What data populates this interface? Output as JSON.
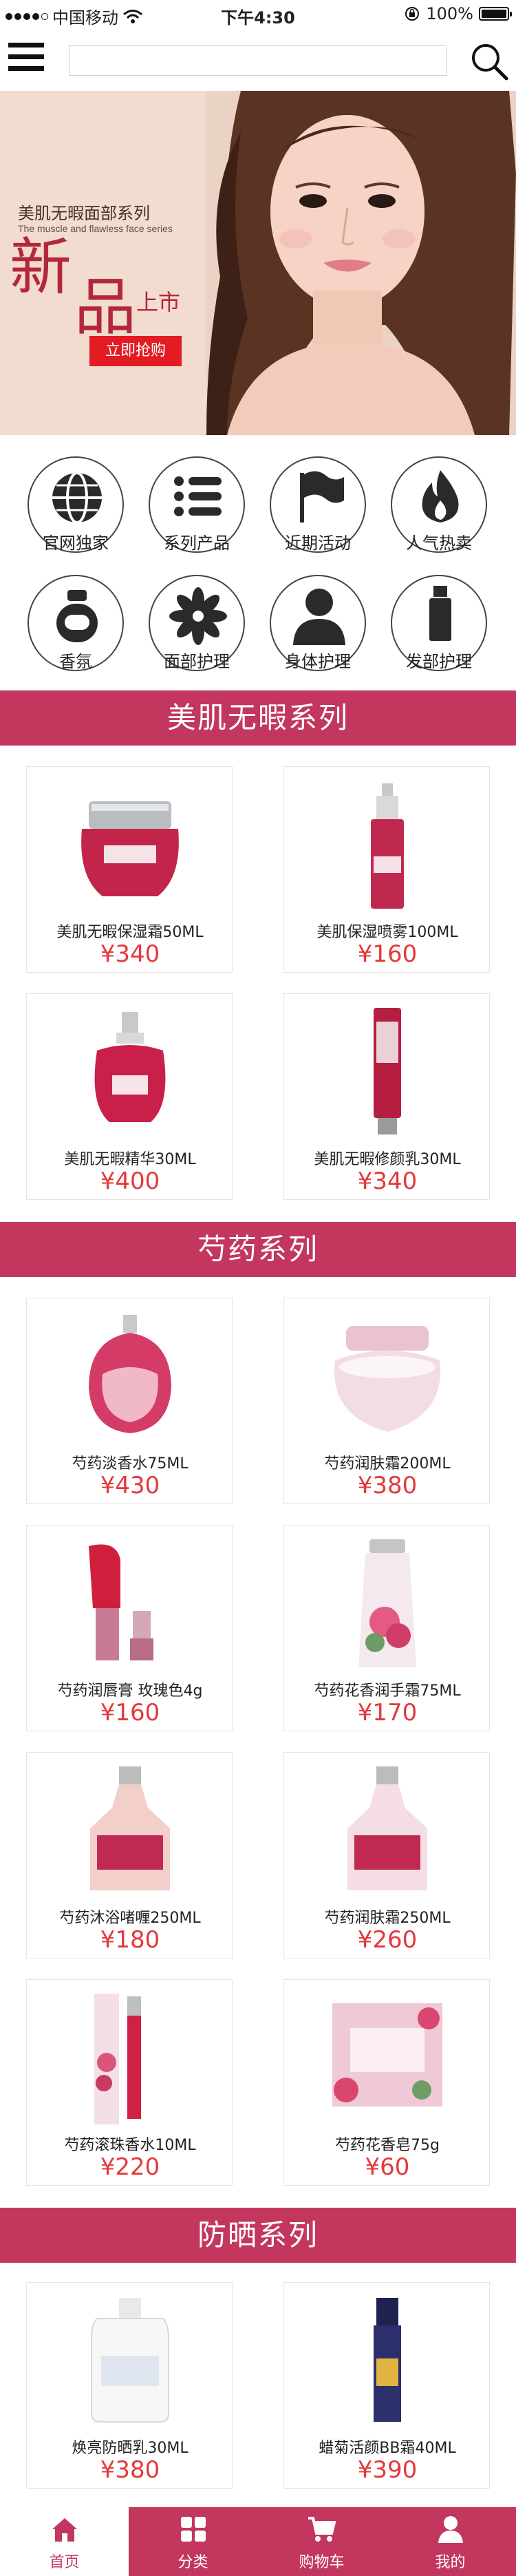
{
  "status_bar": {
    "carrier": "中国移动",
    "time": "下午4:30",
    "battery": "100%"
  },
  "header": {
    "search_placeholder": ""
  },
  "banner": {
    "series_cn": "美肌无暇面部系列",
    "series_en": "The muscle and flawless face series",
    "title_a": "新",
    "title_b": "品",
    "title_c": "上市",
    "buy_button": "立即抢购"
  },
  "categories": [
    {
      "label": "官网独家",
      "icon": "globe-icon"
    },
    {
      "label": "系列产品",
      "icon": "list-icon"
    },
    {
      "label": "近期活动",
      "icon": "flag-icon"
    },
    {
      "label": "人气热卖",
      "icon": "fire-icon"
    },
    {
      "label": "香氛",
      "icon": "perfume-icon"
    },
    {
      "label": "面部护理",
      "icon": "flower-icon"
    },
    {
      "label": "身体护理",
      "icon": "person-icon"
    },
    {
      "label": "发部护理",
      "icon": "bottle-icon"
    }
  ],
  "sections": [
    {
      "title": "美肌无暇系列",
      "products": [
        {
          "name": "美肌无暇保湿霜50ML",
          "price": "¥340"
        },
        {
          "name": "美肌保湿喷雾100ML",
          "price": "¥160"
        },
        {
          "name": "美肌无暇精华30ML",
          "price": "¥400"
        },
        {
          "name": "美肌无暇修颜乳30ML",
          "price": "¥340"
        }
      ]
    },
    {
      "title": "芍药系列",
      "products": [
        {
          "name": "芍药淡香水75ML",
          "price": "¥430"
        },
        {
          "name": "芍药润肤霜200ML",
          "price": "¥380"
        },
        {
          "name": "芍药润唇膏 玫瑰色4g",
          "price": "¥160"
        },
        {
          "name": "芍药花香润手霜75ML",
          "price": "¥170"
        },
        {
          "name": "芍药沐浴啫喱250ML",
          "price": "¥180"
        },
        {
          "name": "芍药润肤霜250ML",
          "price": "¥260"
        },
        {
          "name": "芍药滚珠香水10ML",
          "price": "¥220"
        },
        {
          "name": "芍药花香皂75g",
          "price": "¥60"
        }
      ]
    },
    {
      "title": "防晒系列",
      "products": [
        {
          "name": "焕亮防晒乳30ML",
          "price": "¥380"
        },
        {
          "name": "蜡菊活颜BB霜40ML",
          "price": "¥390"
        }
      ]
    }
  ],
  "tabbar": [
    {
      "label": "首页",
      "icon": "home-icon",
      "active": true
    },
    {
      "label": "分类",
      "icon": "grid-icon",
      "active": false
    },
    {
      "label": "购物车",
      "icon": "cart-icon",
      "active": false
    },
    {
      "label": "我的",
      "icon": "user-icon",
      "active": false
    }
  ],
  "colors": {
    "accent": "#c3375f",
    "price": "#e4393c",
    "buy_button": "#e31b23"
  }
}
